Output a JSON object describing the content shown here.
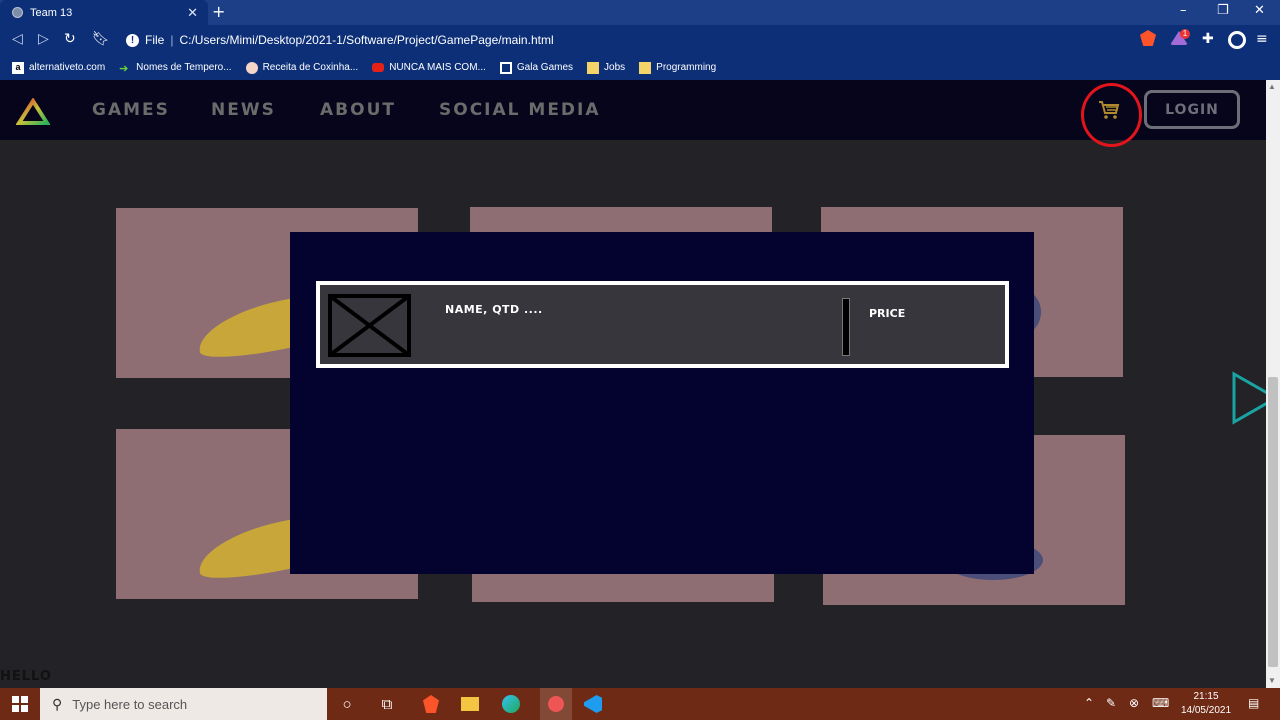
{
  "browser": {
    "tab_title": "Team 13",
    "new_tab": "+",
    "window_controls": {
      "minimize": "–",
      "maximize": "❐",
      "close": "✕"
    },
    "protocol_label": "File",
    "address": "C:/Users/Mimi/Desktop/2021-1/Software/Project/GamePage/main.html",
    "extension_badge": "1",
    "bookmarks": [
      {
        "label": "alternativeto.com",
        "icon": "a-letter-icon"
      },
      {
        "label": "Nomes de Tempero...",
        "icon": "green-arrow-icon"
      },
      {
        "label": "Receita de Coxinha...",
        "icon": "chef-icon"
      },
      {
        "label": "NUNCA MAIS COM...",
        "icon": "youtube-icon"
      },
      {
        "label": "Gala Games",
        "icon": "gala-icon"
      },
      {
        "label": "Jobs",
        "icon": "folder-icon"
      },
      {
        "label": "Programming",
        "icon": "folder-icon"
      }
    ]
  },
  "site": {
    "nav": [
      {
        "label": "GAMES"
      },
      {
        "label": "NEWS"
      },
      {
        "label": "ABOUT"
      },
      {
        "label": "SOCIAL MEDIA"
      }
    ],
    "cart_icon": "shopping-cart-icon",
    "login_label": "LOGIN",
    "footer_text": "HELLO"
  },
  "cart_modal": {
    "item": {
      "name_text": "NAME, QTD ....",
      "price_text": "PRICE"
    }
  },
  "taskbar": {
    "search_placeholder": "Type here to search",
    "time": "21:15",
    "date": "14/05/2021"
  },
  "colors": {
    "nav_bg": "#06051c",
    "modal_bg": "#04032f",
    "card_bg": "#8e6e72",
    "cart_highlight": "#e3141b",
    "accent_teal": "#1aa3a3"
  }
}
